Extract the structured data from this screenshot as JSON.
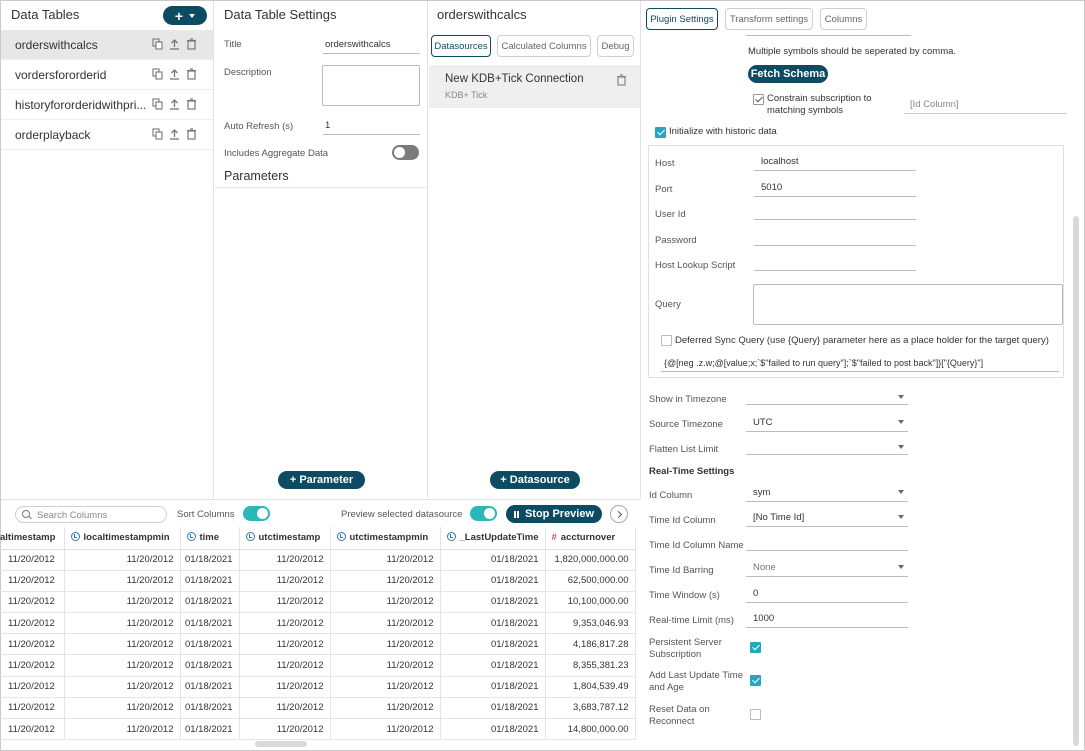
{
  "data_tables": {
    "title": "Data Tables",
    "add_label": "+",
    "items": [
      {
        "name": "orderswithcalcs"
      },
      {
        "name": "vordersfororderid"
      },
      {
        "name": "historyfororderidwithpri..."
      },
      {
        "name": "orderplayback"
      }
    ]
  },
  "settings": {
    "title": "Data Table Settings",
    "title_label": "Title",
    "title_value": "orderswithcalcs",
    "description_label": "Description",
    "auto_refresh_label": "Auto Refresh (s)",
    "auto_refresh_value": "1",
    "aggregate_label": "Includes Aggregate Data",
    "parameters_heading": "Parameters",
    "add_parameter_label": "+ Parameter"
  },
  "datasources": {
    "title": "orderswithcalcs",
    "tabs": [
      "Datasources",
      "Calculated Columns",
      "Debug"
    ],
    "item_name": "New KDB+Tick Connection",
    "item_type": "KDB+ Tick",
    "add_label": "+ Datasource"
  },
  "plugin": {
    "tabs": [
      "Plugin Settings",
      "Transform settings",
      "Columns"
    ],
    "note": "Multiple symbols should be seperated by comma.",
    "fetch_schema": "Fetch Schema",
    "constrain_label": "Constrain subscription to matching symbols",
    "id_column_placeholder": "[Id Column]",
    "init_historic_label": "Initialize with historic data",
    "host_label": "Host",
    "host_value": "localhost",
    "port_label": "Port",
    "port_value": "5010",
    "user_label": "User Id",
    "password_label": "Password",
    "lookup_label": "Host Lookup Script",
    "query_label": "Query",
    "deferred_label": "Deferred Sync Query (use {Query} parameter here as a place holder for the target query)",
    "deferred_value": "{@[neg .z.w;@[value;x;`$\"failed to run query\"];`$\"failed to post back\"]}[\"{Query}\"]",
    "show_tz_label": "Show in Timezone",
    "source_tz_label": "Source Timezone",
    "source_tz_value": "UTC",
    "flatten_label": "Flatten List Limit",
    "rt_heading": "Real-Time Settings",
    "id_col_label": "Id Column",
    "id_col_value": "sym",
    "time_id_label": "Time Id Column",
    "time_id_value": "[No Time Id]",
    "time_id_name_label": "Time Id Column Name",
    "barring_label": "Time Id Barring",
    "barring_value": "None",
    "window_label": "Time Window (s)",
    "window_value": "0",
    "limit_label": "Real-time Limit (ms)",
    "limit_value": "1000",
    "persistent_label": "Persistent Server Subscription",
    "add_last_label": "Add Last Update Time and Age",
    "reset_label": "Reset Data on Reconnect"
  },
  "grid": {
    "search_placeholder": "Search Columns",
    "sort_label": "Sort Columns",
    "preview_label": "Preview selected datasource",
    "stop_label": "Stop Preview",
    "columns": [
      {
        "name": "altimestamp",
        "icon": "none"
      },
      {
        "name": "localtimestampmin",
        "icon": "clock-icon"
      },
      {
        "name": "time",
        "icon": "clock-icon"
      },
      {
        "name": "utctimestamp",
        "icon": "clock-icon"
      },
      {
        "name": "utctimestampmin",
        "icon": "clock-icon"
      },
      {
        "name": "_LastUpdateTime",
        "icon": "clock-icon"
      },
      {
        "name": "accturnover",
        "icon": "hash-icon"
      }
    ],
    "rows": [
      [
        "11/20/2012",
        "11/20/2012",
        "01/18/2021",
        "11/20/2012",
        "11/20/2012",
        "01/18/2021",
        "1,820,000,000.00"
      ],
      [
        "11/20/2012",
        "11/20/2012",
        "01/18/2021",
        "11/20/2012",
        "11/20/2012",
        "01/18/2021",
        "62,500,000.00"
      ],
      [
        "11/20/2012",
        "11/20/2012",
        "01/18/2021",
        "11/20/2012",
        "11/20/2012",
        "01/18/2021",
        "10,100,000.00"
      ],
      [
        "11/20/2012",
        "11/20/2012",
        "01/18/2021",
        "11/20/2012",
        "11/20/2012",
        "01/18/2021",
        "9,353,046.93"
      ],
      [
        "11/20/2012",
        "11/20/2012",
        "01/18/2021",
        "11/20/2012",
        "11/20/2012",
        "01/18/2021",
        "4,186,817.28"
      ],
      [
        "11/20/2012",
        "11/20/2012",
        "01/18/2021",
        "11/20/2012",
        "11/20/2012",
        "01/18/2021",
        "8,355,381.23"
      ],
      [
        "11/20/2012",
        "11/20/2012",
        "01/18/2021",
        "11/20/2012",
        "11/20/2012",
        "01/18/2021",
        "1,804,539.49"
      ],
      [
        "11/20/2012",
        "11/20/2012",
        "01/18/2021",
        "11/20/2012",
        "11/20/2012",
        "01/18/2021",
        "3,683,787.12"
      ],
      [
        "11/20/2012",
        "11/20/2012",
        "01/18/2021",
        "11/20/2012",
        "11/20/2012",
        "01/18/2021",
        "14,800,000.00"
      ]
    ]
  },
  "colors": {
    "accent": "#0d4b63",
    "toggle_on": "#2bb8b8",
    "check_on": "#27a6c2",
    "number_icon": "#e5484d",
    "clock_icon": "#2a7ab8"
  }
}
